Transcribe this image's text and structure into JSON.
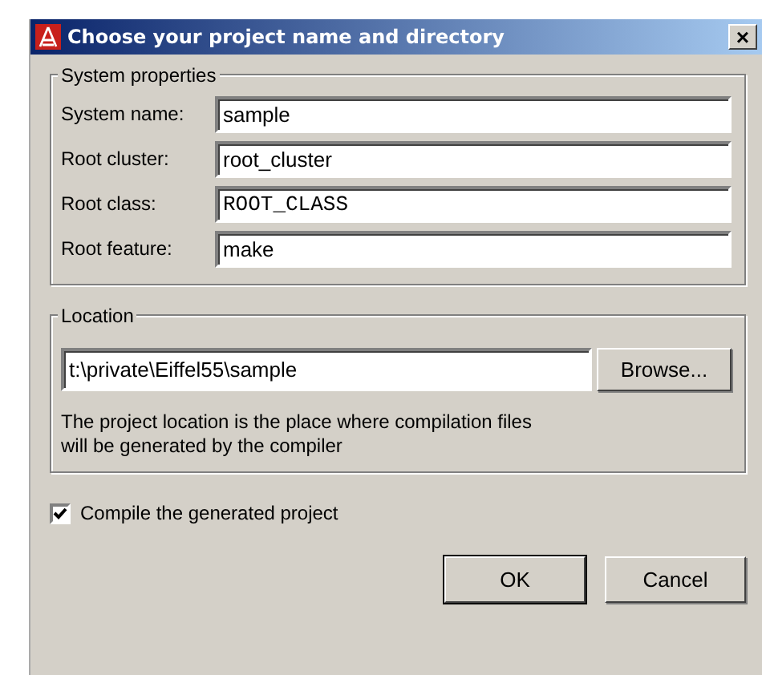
{
  "window": {
    "title": "Choose your project name and directory",
    "close": "×"
  },
  "system_properties": {
    "legend": "System properties",
    "fields": [
      {
        "label": "System name:",
        "value": "sample",
        "kind": "plain"
      },
      {
        "label": "Root cluster:",
        "value": "root_cluster",
        "kind": "plain"
      },
      {
        "label": "Root class:",
        "value": "ROOT_CLASS",
        "kind": "mono"
      },
      {
        "label": "Root feature:",
        "value": "make",
        "kind": "plain"
      }
    ]
  },
  "location": {
    "legend": "Location",
    "value": "t:\\private\\Eiffel55\\sample",
    "browse": "Browse...",
    "note": "The project location is the place where compilation files will be generated by the compiler"
  },
  "compile": {
    "label": "Compile the generated project",
    "checked": true
  },
  "buttons": [
    {
      "label": "OK",
      "default": true
    },
    {
      "label": "Cancel",
      "default": false
    }
  ]
}
